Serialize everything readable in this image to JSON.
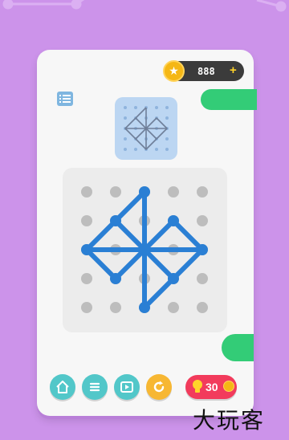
{
  "coins": {
    "count": "888",
    "add_label": "+"
  },
  "hint": {
    "count": "30"
  },
  "watermark": "大玩客",
  "colors": {
    "background": "#cc93ea",
    "line": "#2a7fd4",
    "accent_green": "#33cc77",
    "teal_button": "#52c7c9",
    "restart_button": "#f7b733",
    "hint_button": "#f23b5c",
    "coin": "#f5b715"
  },
  "icons": [
    "star-icon",
    "list-icon",
    "home-icon",
    "menu-icon",
    "video-icon",
    "restart-icon",
    "bulb-icon",
    "coin-icon"
  ]
}
